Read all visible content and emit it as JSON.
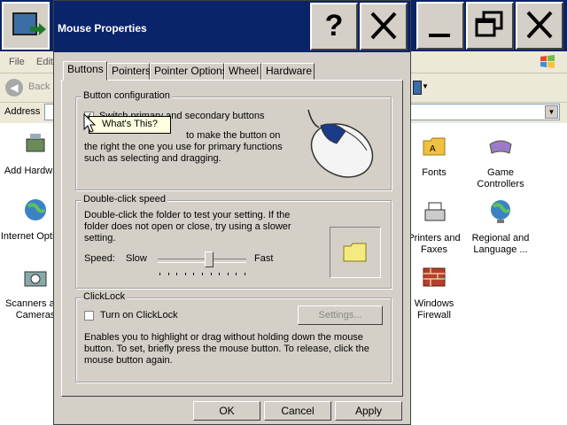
{
  "explorer": {
    "menu": [
      "File",
      "Edit"
    ],
    "back_label": "Back",
    "address_label": "Address",
    "items_left": [
      "Add Hardware",
      "Internet Options",
      "Scanners and Cameras"
    ],
    "items_right": [
      "Fonts",
      "Game Controllers",
      "Printers and Faxes",
      "Regional and Language ...",
      "Windows Firewall"
    ]
  },
  "dialog": {
    "title": "Mouse Properties",
    "tabs": [
      "Buttons",
      "Pointers",
      "Pointer Options",
      "Wheel",
      "Hardware"
    ],
    "active_tab": "Buttons",
    "button_config": {
      "title": "Button configuration",
      "switch_label": "Switch primary and secondary buttons",
      "switch_checked": true,
      "description": "to make the button on the right the one you use for primary functions such as selecting and dragging."
    },
    "double_click": {
      "title": "Double-click speed",
      "description": "Double-click the folder to test your setting. If the folder does not open or close, try using a slower setting.",
      "speed_label": "Speed:",
      "slow_label": "Slow",
      "fast_label": "Fast",
      "speed_value": 0.58
    },
    "clicklock": {
      "title": "ClickLock",
      "checkbox_label": "Turn on ClickLock",
      "checked": false,
      "settings_label": "Settings...",
      "description": "Enables you to highlight or drag without holding down the mouse button. To set, briefly press the mouse button. To release, click the mouse button again."
    },
    "buttons": {
      "ok": "OK",
      "cancel": "Cancel",
      "apply": "Apply"
    }
  },
  "tooltip": {
    "text": "What's This?"
  },
  "title_buttons": {
    "help": "?",
    "close": "✕"
  },
  "window_buttons": {
    "minimize": "_",
    "restore": "❐",
    "close": "✕"
  }
}
